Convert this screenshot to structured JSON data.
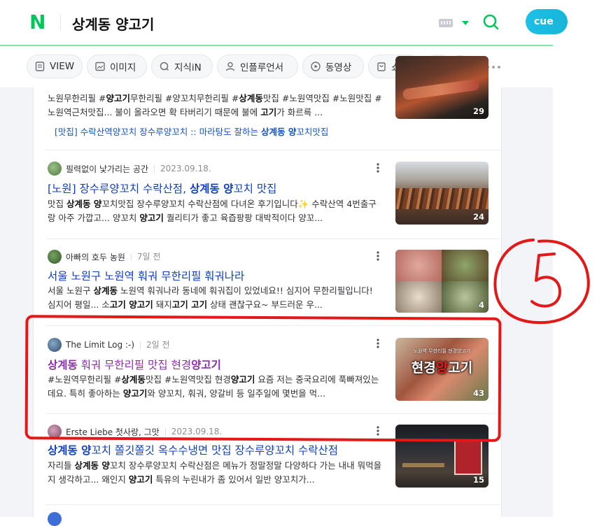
{
  "header": {
    "logo": "N",
    "query": "상계동 양고기",
    "cue_label": "cue",
    "brand_color": "#03c75a"
  },
  "tabs": [
    {
      "label": "VIEW",
      "icon": "document-icon"
    },
    {
      "label": "이미지",
      "icon": "image-icon"
    },
    {
      "label": "지식iN",
      "icon": "q-icon"
    },
    {
      "label": "인플루언서",
      "icon": "person-icon"
    },
    {
      "label": "동영상",
      "icon": "play-icon"
    },
    {
      "label": "쇼핑",
      "icon": "bag-icon"
    }
  ],
  "results": [
    {
      "desc_html": "노원무한리필 #<b>양고기</b>무한리필 #양꼬치무한리필 #<b>상계동</b>맛집 #노원역맛집 #노원맛집 #노원역근처맛집... 불이 올라오면 확 타버리기 때문에 불에 <b>고기</b>가 화르륵 ...",
      "sublink_html": "[맛집] 수락산역양꼬치 장수루양꼬치 :: 마라탕도 잘하는 <b>상계동 양</b>꼬치맛집",
      "thumb_count": "29"
    },
    {
      "author": "필력없이 낯가리는 공간",
      "date": "2023.09.18.",
      "title_html": "[노원] 장수루양꼬치 수락산점, <b>상계동 양</b>꼬치 맛집",
      "desc_html": "맛집 <b>상계동 양</b>꼬치맛집 장수루양꼬치 수락산점에 다녀온 후기입니다✨ 수락산역 4번출구랑 아주 가깝고... 양꼬치 <b>양고기</b> 퀄리티가 좋고 육즙팡팡 대박적이다 양꼬...",
      "thumb_count": "24"
    },
    {
      "author": "아빠의 호두 농원",
      "date": "7일 전",
      "title_html": "서울 노원구 노원역 훠궈 무한리필 훠궈나라",
      "desc_html": "서울 노원구 <b>상계동</b> 노원역 훠궈나라 동네에 훠궈집이 있었네요!! 심지어 무한리필입니다! 심지어 평일... 소<b>고기 양고기</b> 돼지<b>고기 고기</b> 상태 괜찮구요~ 부드러운 우...",
      "thumb_count": "4"
    },
    {
      "author": "The Limit Log :-)",
      "date": "2일 전",
      "title_html": "<b>상계동</b> 훠궈 무한리필 맛집 현경<b>양고기</b>",
      "desc_html": "#노원역무한리필 #<b>상계동</b>맛집 #노원역맛집 현경<b>양고기</b> 요즘 저는 중국요리에 푹빠져있는데요. 특히 좋아하는 <b>양고기</b>와 양꼬치, 훠궈, 양갈비 등 일주일에 몇번을 먹...",
      "thumb_caption": "노원역 무한리필 현경양고기",
      "thumb_text_a": "현경",
      "thumb_text_b": "양",
      "thumb_text_c": "고기",
      "thumb_count": "43"
    },
    {
      "author": "Erste Liebe 첫사랑, 그맛",
      "date": "2023.09.18.",
      "title_html": "<b>상계동 양</b>꼬치 쫄깃쫄깃 옥수수냉면 맛집 장수루양꼬치 수락산점",
      "desc_html": "자리들 <b>상계동 양</b>꼬치 장수루양꼬치 수락산점은 메뉴가 정말정말 다양하다 가는 내내 뭐먹을지 생각하고... 왜인지 <b>양고기</b> 특유의 누린내가 좀 있어서 일반 양꼬치가...",
      "thumb_count": "15"
    }
  ],
  "annotation": {
    "label": "5",
    "color": "#e31818"
  }
}
